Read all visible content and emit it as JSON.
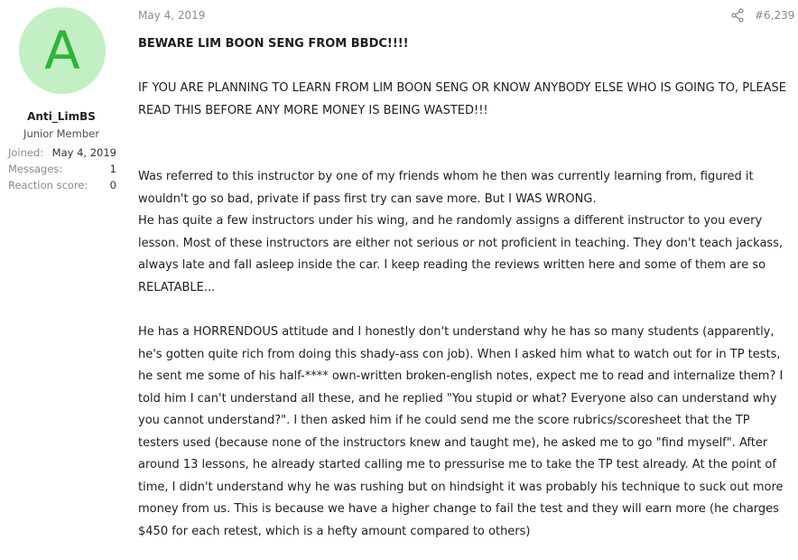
{
  "user": {
    "avatar_letter": "A",
    "name": "Anti_LimBS",
    "title": "Junior Member",
    "stats": [
      {
        "label": "Joined:",
        "value": "May 4, 2019"
      },
      {
        "label": "Messages:",
        "value": "1"
      },
      {
        "label": "Reaction score:",
        "value": "0"
      }
    ]
  },
  "post": {
    "date": "May 4, 2019",
    "number": "#6,239",
    "heading": "BEWARE LIM BOON SENG FROM BBDC!!!!",
    "paragraphs": [
      "IF YOU ARE PLANNING TO LEARN FROM LIM BOON SENG OR KNOW ANYBODY ELSE WHO IS GOING TO, PLEASE READ THIS BEFORE ANY MORE MONEY IS BEING WASTED!!!",
      "Was referred to this instructor by one of my friends whom he then was currently learning from, figured it wouldn't go so bad, private if pass first try can save more. But I WAS WRONG.",
      "He has quite a few instructors under his wing, and he randomly assigns a different instructor to you every lesson. Most of these instructors are either not serious or not proficient in teaching. They don't teach jackass, always late and fall asleep inside the car. I keep reading the reviews written here and some of them are so RELATABLE...",
      "He has a HORRENDOUS attitude and I honestly don't understand why he has so many students (apparently, he's gotten quite rich from doing this shady-ass con job). When I asked him what to watch out for in TP tests, he sent me some of his half-**** own-written broken-english notes, expect me to read and internalize them? I told him I can't understand all these, and he replied \"You stupid or what? Everyone also can understand why you cannot understand?\". I then asked him if he could send me the score rubrics/scoresheet that the TP testers used (because none of the instructors knew and taught me), he asked me to go \"find myself\". After around 13 lessons, he already started calling me to pressurise me to take the TP test already. At the point of time, I didn't understand why he was rushing but on hindsight it was probably his technique to suck out more money from us. This is because we have a higher change to fail the test and they will earn more (he charges $450 for each retest, which is a hefty amount compared to others)"
    ]
  },
  "icons": {
    "share": "share-icon"
  },
  "colors": {
    "avatar_bg": "#c2efc4",
    "avatar_fg": "#2fb43a"
  }
}
